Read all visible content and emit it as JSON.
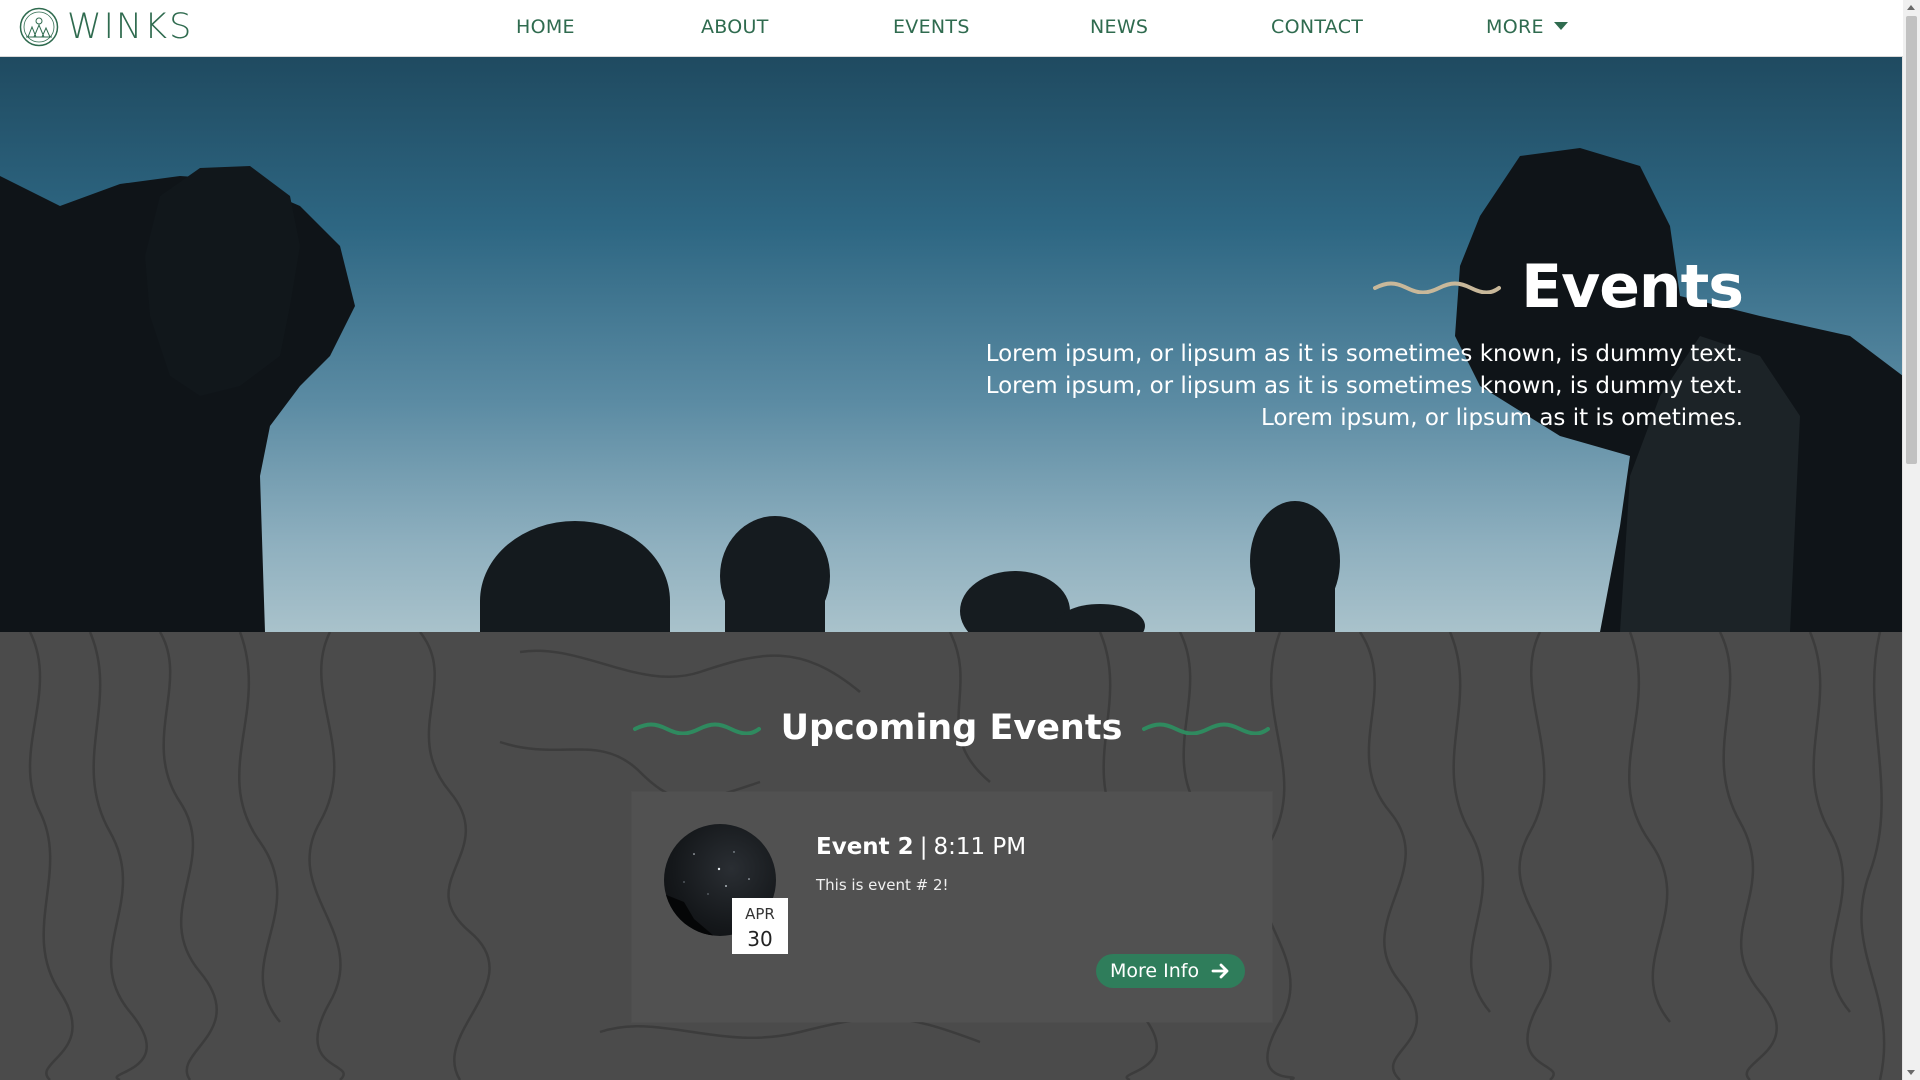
{
  "brand": {
    "name": "WINKS",
    "logo_icon": "forest-badge-icon"
  },
  "nav": {
    "items": [
      {
        "label": "HOME"
      },
      {
        "label": "ABOUT"
      },
      {
        "label": "EVENTS"
      },
      {
        "label": "NEWS"
      },
      {
        "label": "CONTACT"
      },
      {
        "label": "MORE"
      }
    ],
    "more_icon": "caret-down-icon"
  },
  "hero": {
    "title": "Events",
    "text": "Lorem ipsum, or lipsum as it is sometimes known, is dummy text. Lorem ipsum, or lipsum as it is sometimes known, is dummy text. Lorem ipsum, or lipsum as it is ometimes."
  },
  "upcoming": {
    "heading": "Upcoming Events",
    "events": [
      {
        "name": "Event 2",
        "separator": "|",
        "time": "8:11 PM",
        "description": "This is event # 2!",
        "month": "APR",
        "day": "30",
        "button_label": "More Info"
      }
    ]
  },
  "colors": {
    "brand_green": "#2f6b4f",
    "button_green": "#2f7d5b",
    "hero_squiggle": "#c8b89a",
    "section_bg": "#4b4b4b"
  }
}
